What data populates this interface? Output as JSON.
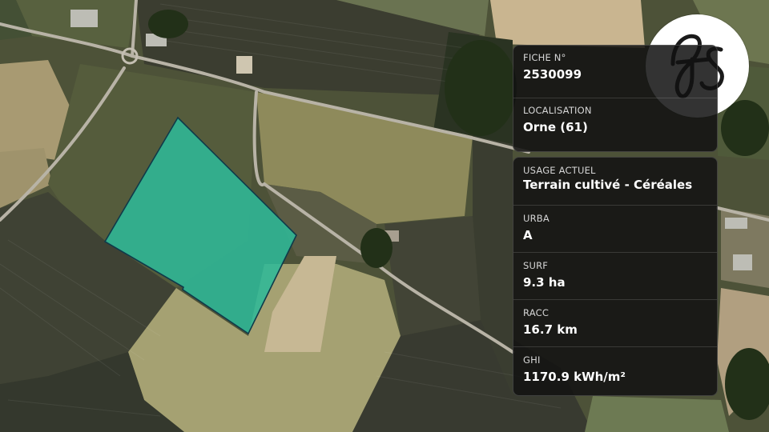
{
  "fiche": {
    "label": "FICHE N°",
    "value": "2530099"
  },
  "localisation": {
    "label": "LOCALISATION",
    "value": "Orne (61)"
  },
  "usage": {
    "label": "USAGE ACTUEL",
    "value": "Terrain cultivé - Céréales"
  },
  "urba": {
    "label": "URBA",
    "value": "A"
  },
  "surf": {
    "label": "SURF",
    "value": "9.3 ha"
  },
  "racc": {
    "label": "RACC",
    "value": "16.7 km"
  },
  "ghi": {
    "label": "GHI",
    "value": "1170.9 kWh/m²"
  },
  "logo": {
    "text": "fs"
  },
  "colors": {
    "parcel_fill": "#2fb897",
    "parcel_stroke": "#0f3a4a",
    "card_bg": "#121212"
  }
}
